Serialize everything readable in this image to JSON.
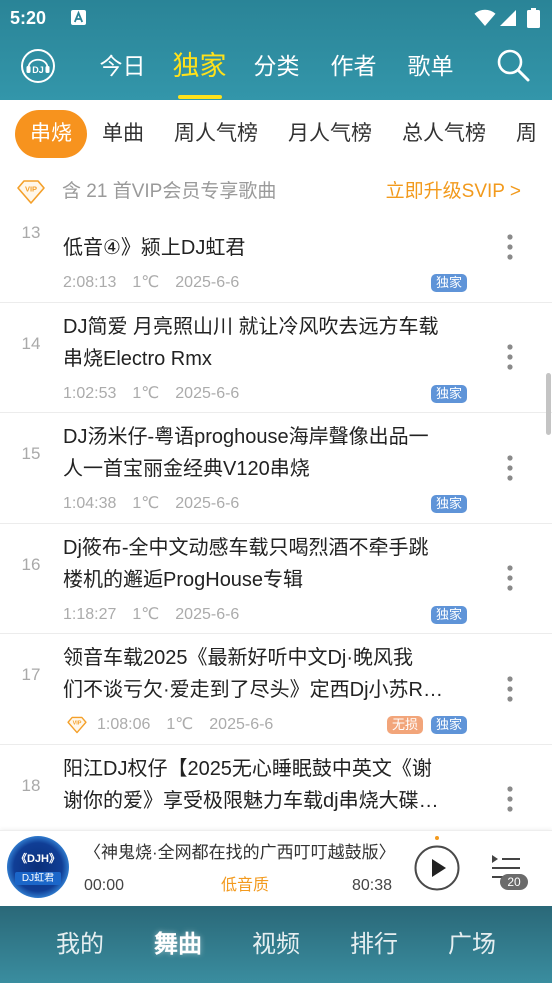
{
  "status_bar": {
    "time": "5:20"
  },
  "header": {
    "logo_text": "DJ",
    "tabs": [
      {
        "label": "今日",
        "selected": false
      },
      {
        "label": "独家",
        "selected": true
      },
      {
        "label": "分类",
        "selected": false
      },
      {
        "label": "作者",
        "selected": false
      },
      {
        "label": "歌单",
        "selected": false
      }
    ]
  },
  "sub_tabs": [
    {
      "label": "串烧",
      "selected": true
    },
    {
      "label": "单曲",
      "selected": false
    },
    {
      "label": "周人气榜",
      "selected": false
    },
    {
      "label": "月人气榜",
      "selected": false
    },
    {
      "label": "总人气榜",
      "selected": false
    },
    {
      "label": "周",
      "selected": false
    }
  ],
  "vip_banner": {
    "badge": "VIP",
    "text": "含 21 首VIP会员专享歌曲",
    "action": "立即升级SVIP >"
  },
  "songs": [
    {
      "rank": "13",
      "title_lines": [
        "低音④》颍上DJ虹君"
      ],
      "duration": "2:08:13",
      "heat": "1℃",
      "date": "2025-6-6",
      "badges": [
        "独家"
      ],
      "vip": false
    },
    {
      "rank": "14",
      "title_lines": [
        "DJ简爱 月亮照山川 就让冷风吹去远方车载",
        "串烧Electro Rmx"
      ],
      "duration": "1:02:53",
      "heat": "1℃",
      "date": "2025-6-6",
      "badges": [
        "独家"
      ],
      "vip": false
    },
    {
      "rank": "15",
      "title_lines": [
        "DJ汤米仔-粤语proghouse海岸聲像出品一",
        "人一首宝丽金经典V120串烧"
      ],
      "duration": "1:04:38",
      "heat": "1℃",
      "date": "2025-6-6",
      "badges": [
        "独家"
      ],
      "vip": false
    },
    {
      "rank": "16",
      "title_lines": [
        "Dj筱布-全中文动感车载只喝烈酒不牵手跳",
        "楼机的邂逅ProgHouse专辑"
      ],
      "duration": "1:18:27",
      "heat": "1℃",
      "date": "2025-6-6",
      "badges": [
        "独家"
      ],
      "vip": false
    },
    {
      "rank": "17",
      "title_lines": [
        "领音车载2025《最新好听中文Dj·晚风我",
        "们不谈亏欠·爱走到了尽头》定西Dj小苏R…"
      ],
      "duration": "1:08:06",
      "heat": "1℃",
      "date": "2025-6-6",
      "badges": [
        "无损",
        "独家"
      ],
      "vip": true
    },
    {
      "rank": "18",
      "title_lines": [
        "阳江DJ权仔【2025无心睡眠鼓中英文《谢",
        "谢你的爱》享受极限魅力车载dj串烧大碟…"
      ]
    }
  ],
  "player": {
    "art_logo": "《DJH》",
    "art_name": "DJ虹君",
    "title": "〈神鬼烧·全网都在找的广西叮叮越鼓版〉",
    "elapsed": "00:00",
    "quality": "低音质",
    "total": "80:38",
    "queue_count": "20"
  },
  "bottom_nav": [
    {
      "label": "我的",
      "selected": false
    },
    {
      "label": "舞曲",
      "selected": true
    },
    {
      "label": "视频",
      "selected": false
    },
    {
      "label": "排行",
      "selected": false
    },
    {
      "label": "广场",
      "selected": false
    }
  ],
  "icons": {
    "notification": "a-notification-icon",
    "wifi": "wifi-icon",
    "signal": "signal-icon",
    "battery": "battery-icon",
    "logo": "dj-logo-icon",
    "search": "search-icon",
    "vip": "vip-icon",
    "more": "more-options-icon",
    "play": "play-icon",
    "playlist": "playlist-icon"
  },
  "colors": {
    "header_teal": "#2e8ca0",
    "bottom_nav_teal": "#2f7889",
    "selected_tab_yellow": "#ffe11a",
    "accent_orange": "#f7931e",
    "vip_orange": "#f29a1c",
    "exclusive_badge_blue": "#5f94d8",
    "lossless_badge_orange": "#f2a57a"
  }
}
